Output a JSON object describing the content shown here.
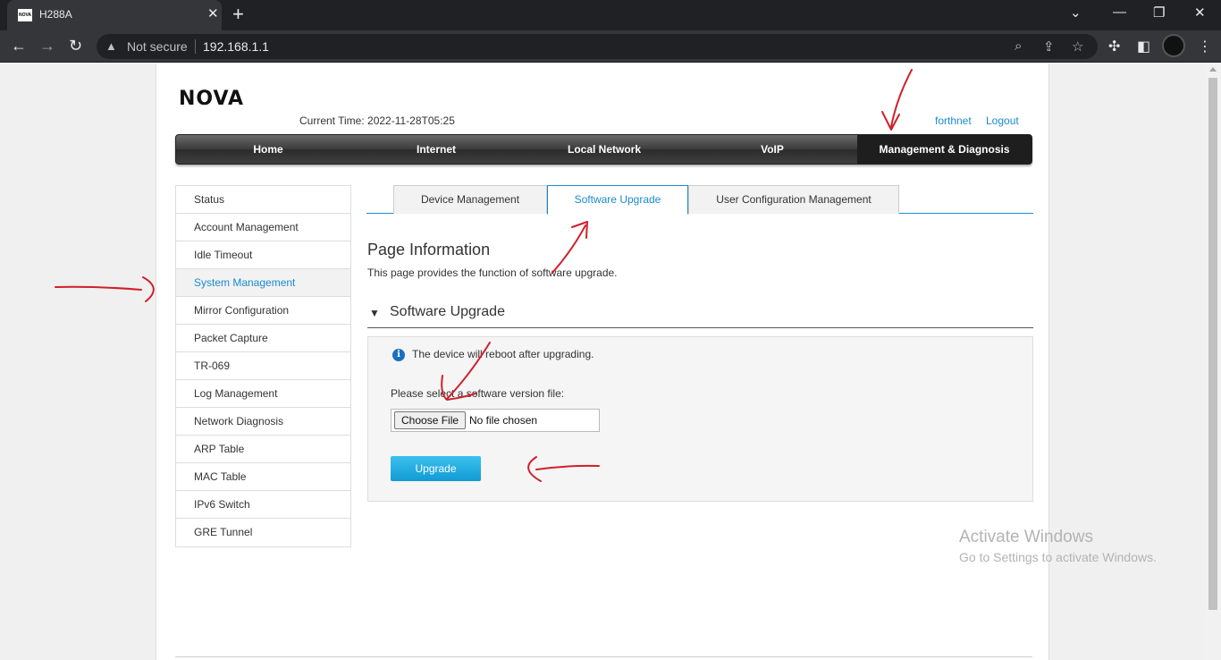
{
  "browser": {
    "tab_title": "H288A",
    "tab_favicon_text": "NOVA",
    "security_label": "Not secure",
    "url": "192.168.1.1"
  },
  "header": {
    "logo": "NOVA",
    "current_time_label": "Current Time: 2022-11-28T05:25",
    "user_link": "forthnet",
    "logout_link": "Logout"
  },
  "main_nav": {
    "items": [
      "Home",
      "Internet",
      "Local Network",
      "VoIP",
      "Management & Diagnosis"
    ],
    "active": "Management & Diagnosis"
  },
  "side_menu": {
    "items": [
      "Status",
      "Account Management",
      "Idle Timeout",
      "System Management",
      "Mirror Configuration",
      "Packet Capture",
      "TR-069",
      "Log Management",
      "Network Diagnosis",
      "ARP Table",
      "MAC Table",
      "IPv6 Switch",
      "GRE Tunnel"
    ],
    "active": "System Management"
  },
  "sub_tabs": {
    "items": [
      "Device Management",
      "Software Upgrade",
      "User Configuration Management"
    ],
    "active": "Software Upgrade"
  },
  "page_info": {
    "title": "Page Information",
    "description": "This page provides the function of software upgrade."
  },
  "section": {
    "title": "Software Upgrade",
    "notice": "The device will reboot after upgrading.",
    "select_label": "Please select a software version file:",
    "choose_file_label": "Choose File",
    "file_status": "No file chosen",
    "upgrade_label": "Upgrade"
  },
  "watermark": {
    "line1": "Activate Windows",
    "line2": "Go to Settings to activate Windows."
  },
  "colors": {
    "accent": "#1a8bd0",
    "annotation": "#d0202a",
    "upgrade_button": "#1ba6de"
  }
}
